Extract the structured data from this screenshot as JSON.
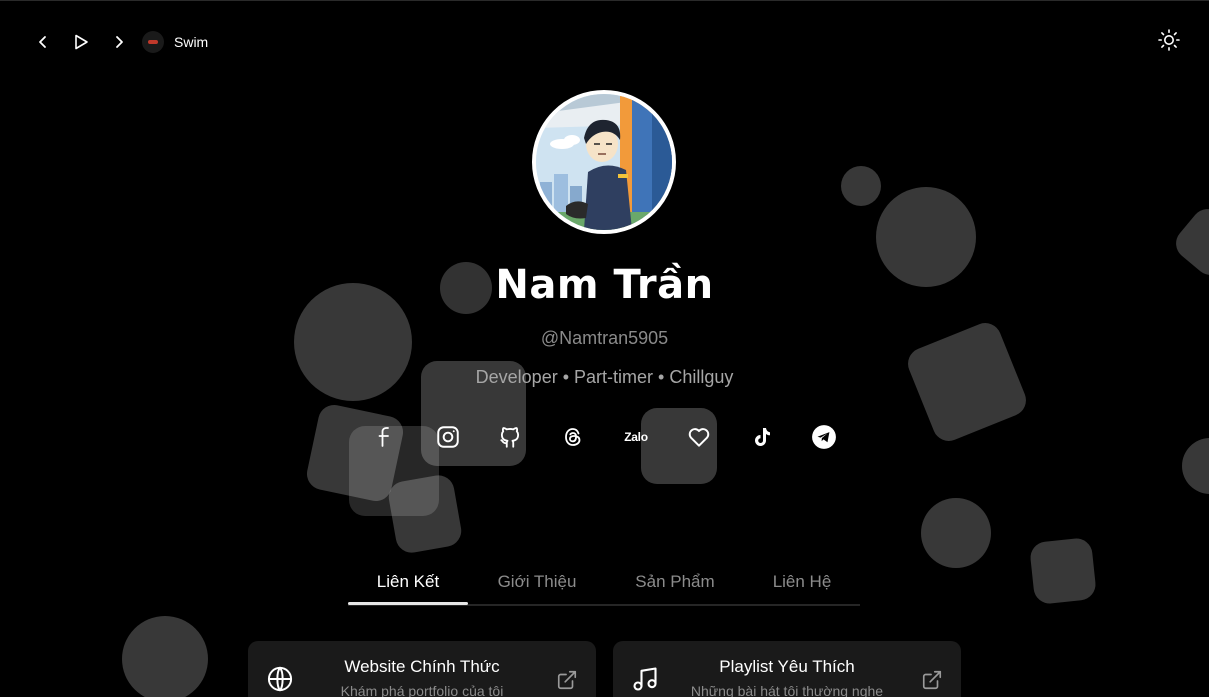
{
  "player": {
    "track_name": "Swim",
    "controls": [
      "previous",
      "play",
      "next"
    ]
  },
  "theme_toggle": {
    "icon": "sun-icon"
  },
  "profile": {
    "name": "Nam Trần",
    "handle": "@Namtran5905",
    "bio": "Developer • Part-timer • Chillguy"
  },
  "socials": {
    "items": [
      {
        "name": "facebook",
        "icon": "facebook-icon"
      },
      {
        "name": "instagram",
        "icon": "instagram-icon"
      },
      {
        "name": "github",
        "icon": "github-icon"
      },
      {
        "name": "threads",
        "icon": "threads-icon"
      },
      {
        "name": "zalo",
        "icon": "zalo-icon",
        "label": "Zalo"
      },
      {
        "name": "heart",
        "icon": "heart-icon"
      },
      {
        "name": "tiktok",
        "icon": "tiktok-icon"
      },
      {
        "name": "telegram",
        "icon": "telegram-icon"
      }
    ]
  },
  "tabs": {
    "items": [
      {
        "label": "Liên Kết",
        "active": true
      },
      {
        "label": "Giới Thiệu",
        "active": false
      },
      {
        "label": "Sản Phẩm",
        "active": false
      },
      {
        "label": "Liên Hệ",
        "active": false
      }
    ]
  },
  "cards": {
    "items": [
      {
        "title": "Website Chính Thức",
        "description": "Khám phá portfolio của tôi",
        "icon": "globe-icon"
      },
      {
        "title": "Playlist Yêu Thích",
        "description": "Những bài hát tôi thường nghe",
        "icon": "music-icon"
      }
    ]
  },
  "colors": {
    "background": "#000000",
    "text_primary": "#ffffff",
    "text_muted": "#8c8c8c",
    "card_bg": "#1a1a1a"
  }
}
